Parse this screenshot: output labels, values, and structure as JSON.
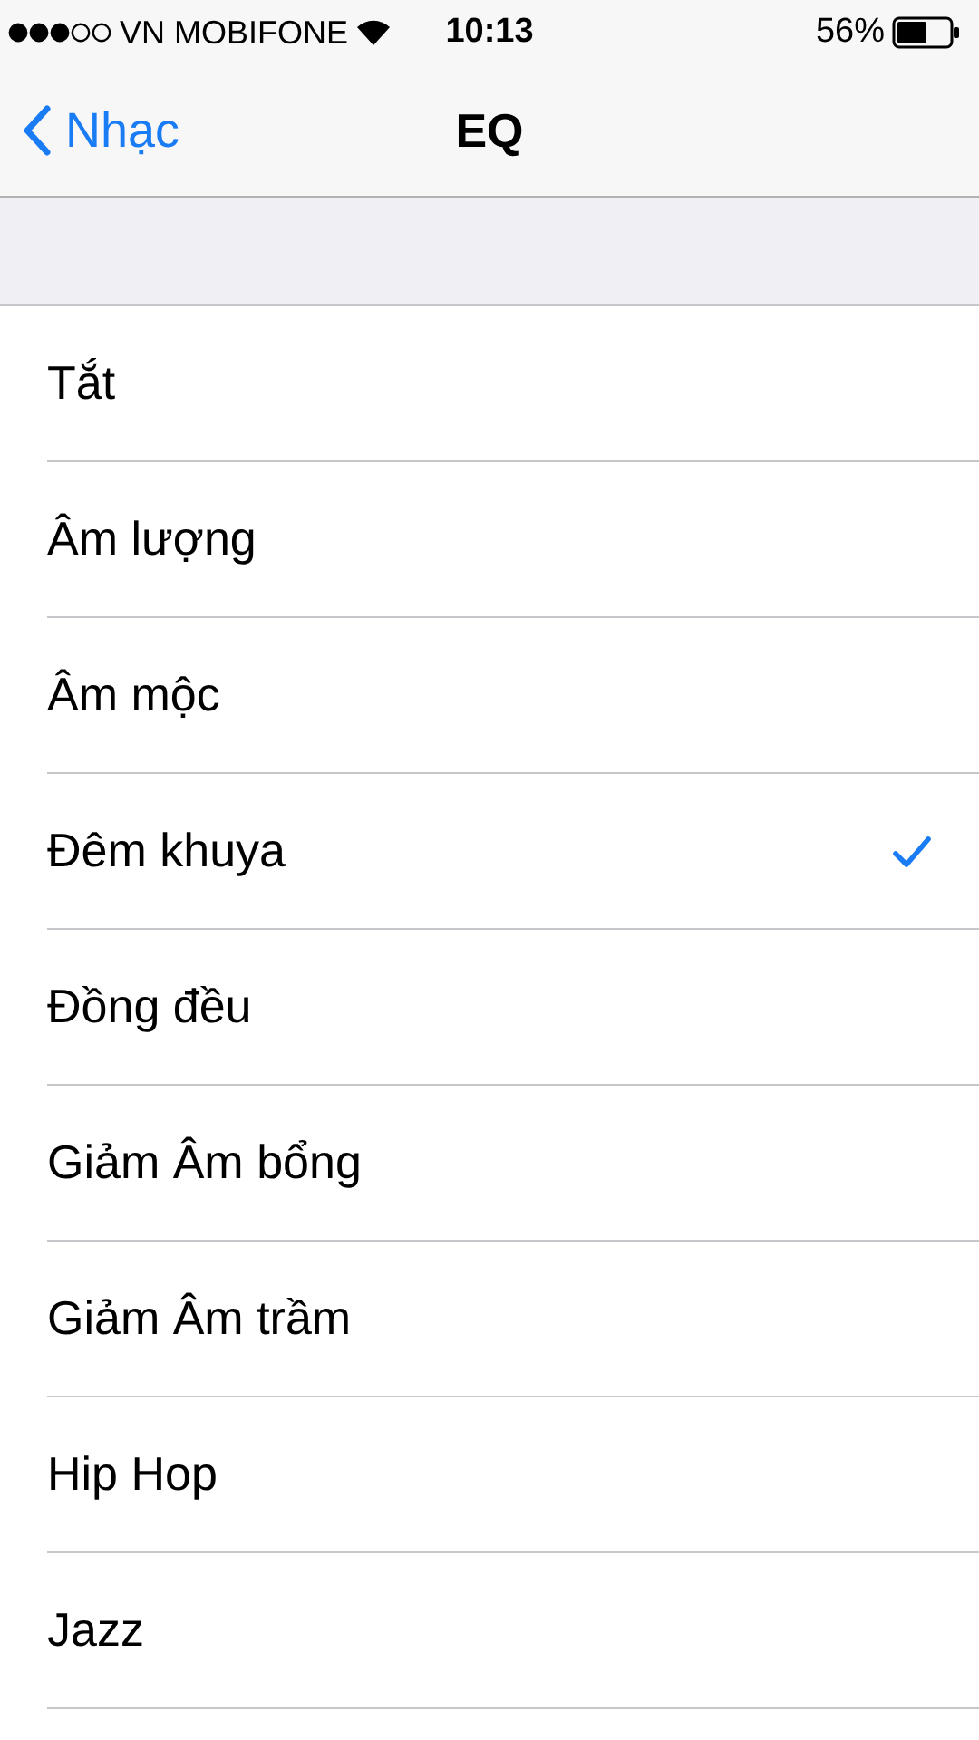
{
  "status_bar": {
    "carrier": "VN MOBIFONE",
    "time": "10:13",
    "battery": "56%"
  },
  "nav": {
    "back_label": "Nhạc",
    "title": "EQ"
  },
  "options": [
    {
      "label": "Tắt",
      "selected": false
    },
    {
      "label": "Âm lượng",
      "selected": false
    },
    {
      "label": "Âm mộc",
      "selected": false
    },
    {
      "label": "Đêm khuya",
      "selected": true
    },
    {
      "label": "Đồng đều",
      "selected": false
    },
    {
      "label": "Giảm Âm bổng",
      "selected": false
    },
    {
      "label": "Giảm Âm trầm",
      "selected": false
    },
    {
      "label": "Hip Hop",
      "selected": false
    },
    {
      "label": "Jazz",
      "selected": false
    }
  ]
}
